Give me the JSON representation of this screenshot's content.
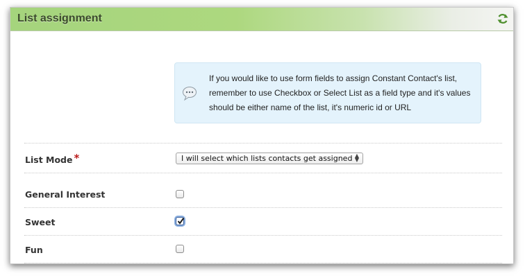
{
  "panel": {
    "title": "List assignment",
    "refresh_icon": "refresh-icon"
  },
  "info": {
    "icon": "speech-bubble-icon",
    "text": "If you would like to use form fields to assign Constant Contact's list, remember to use Checkbox or Select List as a field type and it's values should be either name of the list, it's numeric id or URL"
  },
  "list_mode": {
    "label": "List Mode",
    "required_mark": "*",
    "selected_option": "I will select which lists contacts get assigned"
  },
  "lists": [
    {
      "label": "General Interest",
      "checked": false
    },
    {
      "label": "Sweet",
      "checked": true
    },
    {
      "label": "Fun",
      "checked": false
    }
  ],
  "colors": {
    "header_green": "#a5d47d",
    "info_bg": "#e4f3fc",
    "required": "#bb1b1b"
  }
}
